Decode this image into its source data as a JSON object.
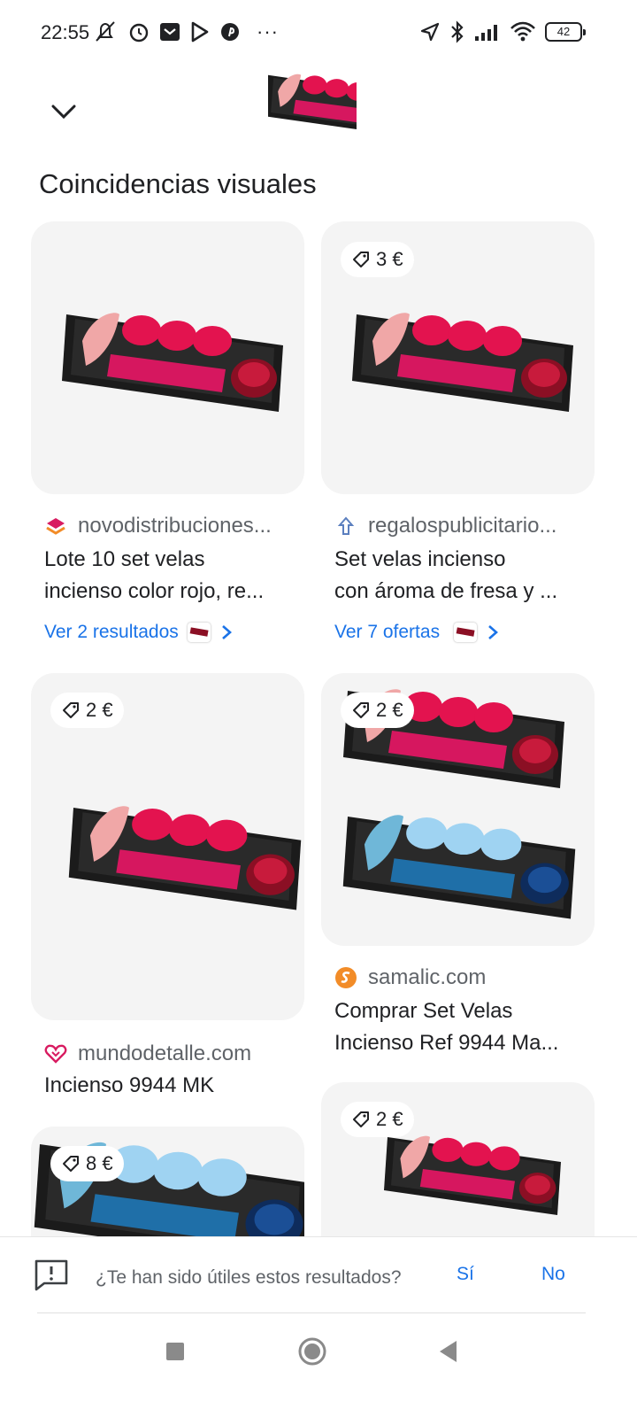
{
  "status_bar": {
    "time": "22:55",
    "battery": "42",
    "overflow": "···"
  },
  "header": {
    "collapse_icon": "chevron-down-icon",
    "section_title": "Coincidencias visuales"
  },
  "results": [
    {
      "source": "novodistribuciones...",
      "title_line1": "Lote 10 set velas",
      "title_line2": "incienso color rojo, re...",
      "link": "Ver 2 resultados",
      "price": "",
      "icon_color": "#e8553d"
    },
    {
      "source": "regalospublicitario...",
      "title_line1": "Set velas incienso",
      "title_line2": "con ároma de fresa y ...",
      "link": "Ver 7 ofertas",
      "price": "3 €",
      "icon_color": "#5b7fbf"
    },
    {
      "source": "mundodetalle.com",
      "title_line1": "Incienso 9944 MK",
      "title_line2": "",
      "link": "",
      "price": "2 €",
      "icon_color": "#d81b60"
    },
    {
      "source": "samalic.com",
      "title_line1": "Comprar Set Velas",
      "title_line2": "Incienso Ref 9944 Ma...",
      "link": "",
      "price": "2 €",
      "icon_color": "#f28c28"
    },
    {
      "source": "",
      "title_line1": "",
      "title_line2": "",
      "link": "",
      "price": "8 €",
      "icon_color": ""
    },
    {
      "source": "",
      "title_line1": "",
      "title_line2": "",
      "link": "",
      "price": "2 €",
      "icon_color": ""
    }
  ],
  "feedback": {
    "question": "¿Te han sido útiles estos resultados?",
    "yes": "Sí",
    "no": "No"
  },
  "colors": {
    "link_blue": "#1a73e8",
    "card_bg": "#f4f4f4",
    "candle_red": "#e3134f",
    "candle_blue": "#7ec3ea"
  }
}
